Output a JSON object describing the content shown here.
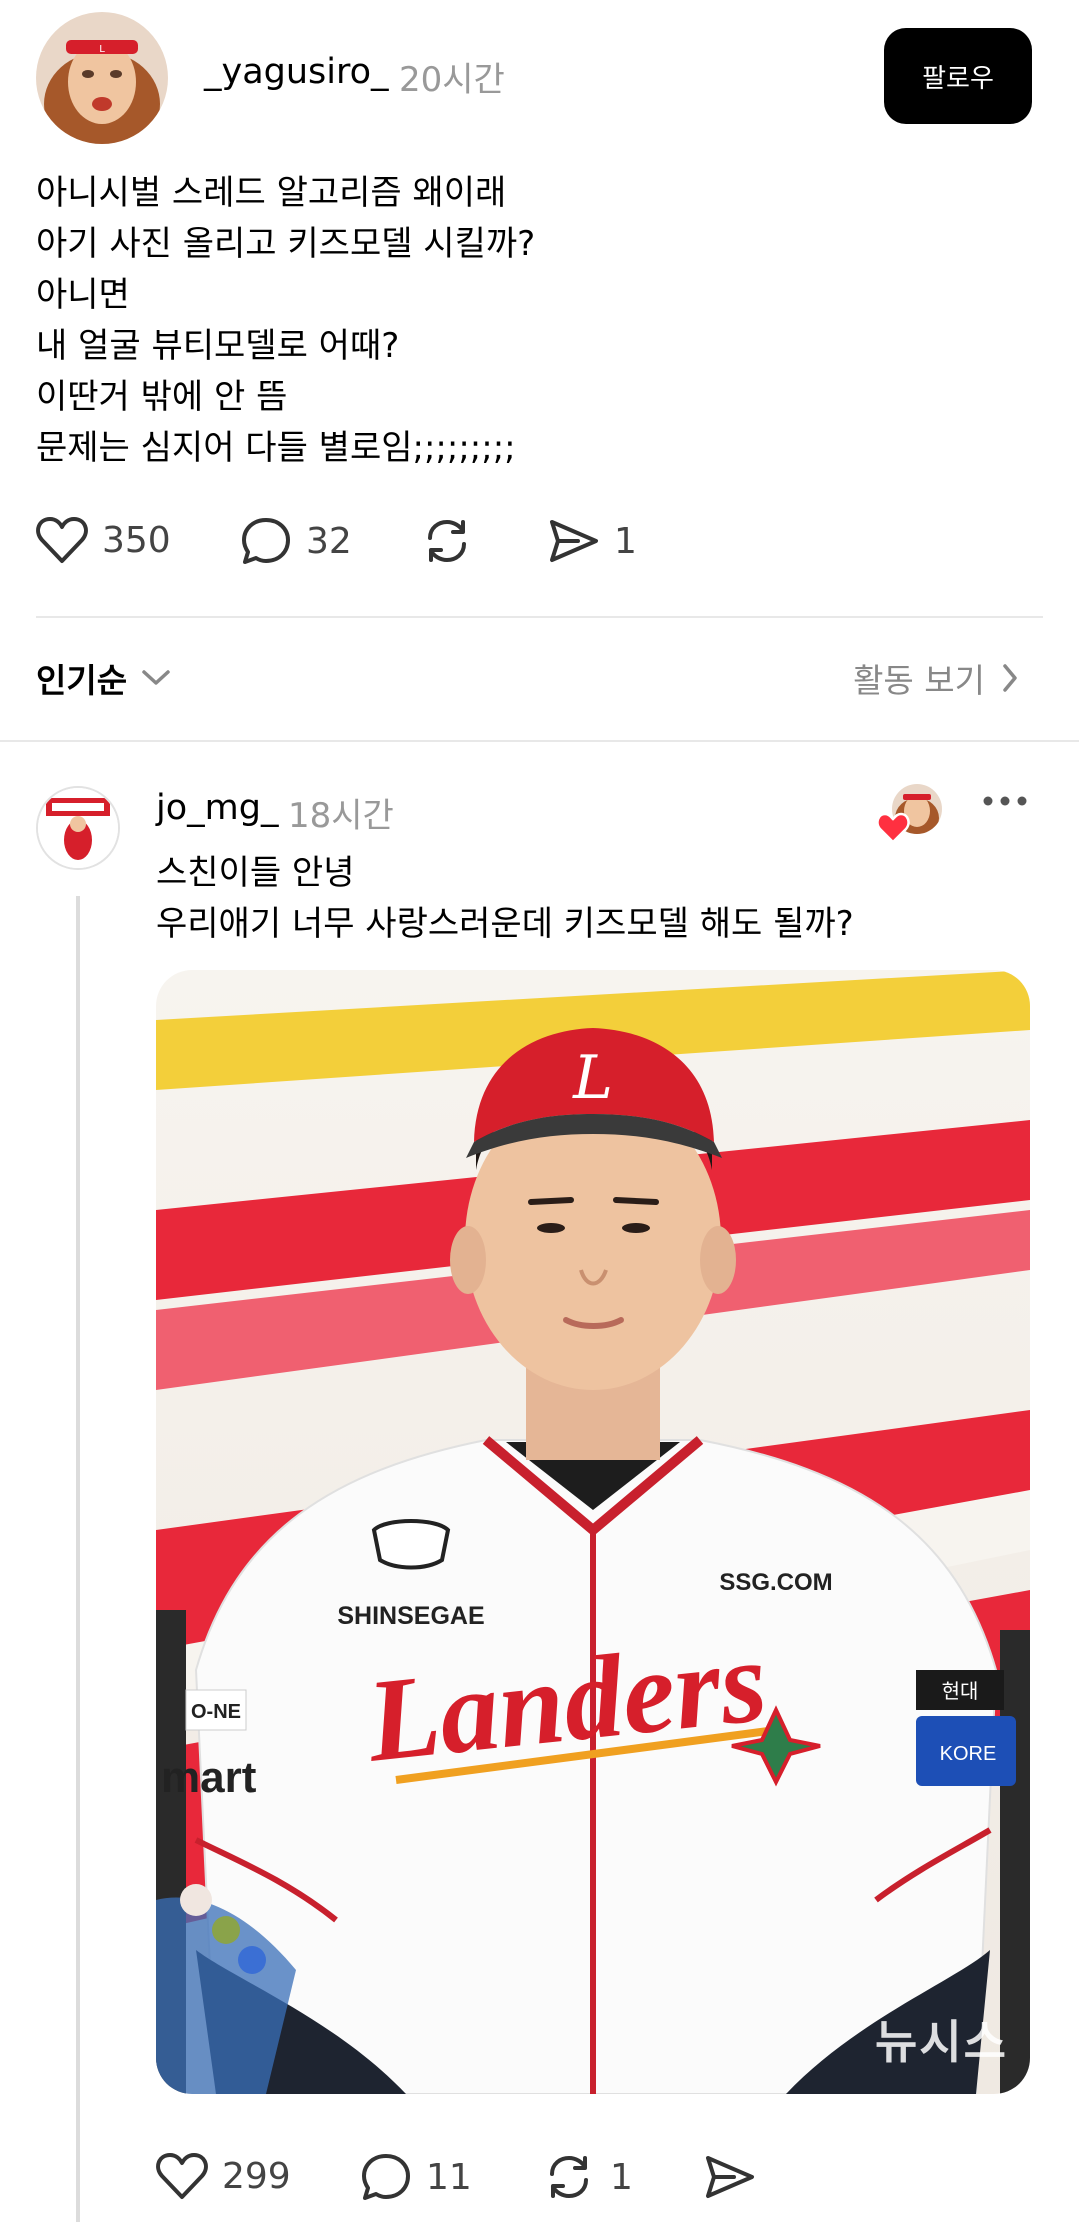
{
  "post": {
    "username": "_yagusiro_",
    "time": "20시간",
    "follow_label": "팔로우",
    "text": "아니시벌 스레드 알고리즘 왜이래\n아기 사진 올리고 키즈모델 시킬까?\n아니면\n내 얼굴 뷰티모델로 어때?\n이딴거 밖에 안 뜸\n문제는 심지어 다들 별로임;;;;;;;;;",
    "likes": "350",
    "comments": "32",
    "reposts": "",
    "shares": "1"
  },
  "sort": {
    "label": "인기순",
    "activity_label": "활동 보기"
  },
  "reply": {
    "username": "jo_mg_",
    "time": "18시간",
    "text": "스친이들 안녕\n우리애기 너무 사랑스러운데 키즈모델 해도 될까?",
    "photo": {
      "jersey_brand": "SHINSEGAE",
      "sponsor": "SSG.COM",
      "team": "Landers",
      "left_patch_top": "O-NE",
      "left_patch_bottom": "mart",
      "right_patch_top": "현대",
      "right_patch_bottom": "KORE",
      "cap_letter": "L",
      "watermark": "뉴시스"
    },
    "likes": "299",
    "comments": "11",
    "reposts": "1",
    "shares": ""
  },
  "colors": {
    "accent_red": "#d61f2b",
    "heart_red": "#ff3040",
    "follow_bg": "#000000"
  }
}
